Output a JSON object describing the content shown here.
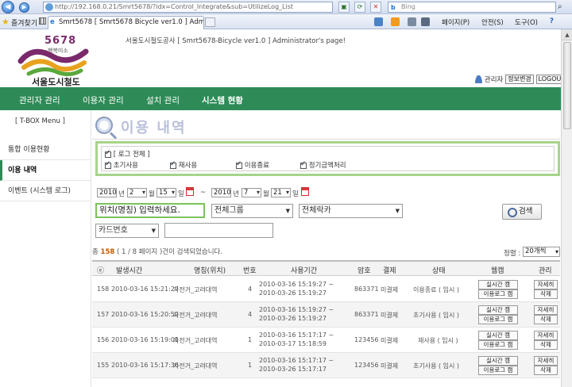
{
  "browser": {
    "address": "http://192.168.0.21/Smrt5678/?idx=Control_Integrate&sub=UtilizeLog_List",
    "search_placeholder": "Bing",
    "favorites_label": "즐겨찾기",
    "tab_title": "Smrt5678 [ Smrt5678 Bicycle ver1.0 ] Adminis...",
    "commands": {
      "page": "페이지(P)",
      "safety": "안전(S)",
      "tools": "도구(O)",
      "help": "?"
    }
  },
  "header": {
    "logo_number": "5678",
    "logo_sub": "행복미소",
    "logo_name": "서울도시철도",
    "caption": "서울도시철도공사 [ Smrt5678-Bicycle ver1.0 ] Administrator's page!",
    "admin_label": "관리자",
    "info_change": "정보변경",
    "logout": "LOGOUT"
  },
  "nav": [
    "관리자 관리",
    "이용자 관리",
    "설치 관리",
    "시스템 현황"
  ],
  "sidebar": {
    "title": "[ T-BOX Menu ]",
    "items": [
      "통합 이용현황",
      "이용 내역",
      "이벤트 (시스템 로그)"
    ]
  },
  "page": {
    "title": "이용 내역"
  },
  "filters": {
    "all_label": "[ 로그 전체 ]",
    "options": [
      "초기사용",
      "재사용",
      "이용종료",
      "정기금액처리"
    ]
  },
  "date": {
    "from_year": "2010",
    "from_month": "2",
    "from_day": "15",
    "to_year": "2010",
    "to_month": "7",
    "to_day": "21",
    "year_unit": "년",
    "month_unit": "월",
    "day_unit": "일",
    "tilde": "~"
  },
  "search": {
    "location_placeholder": "위치(명칭) 입력하세요.",
    "group_select": "전체그룹",
    "rack_select": "전체락카",
    "card_select": "카드번호",
    "button": "검색"
  },
  "results": {
    "prefix": "총",
    "count": "158",
    "suffix": "( 1 / 8 페이지 )건이 검색되었습니다.",
    "sort_label": "정렬 :",
    "sort_value": "20개씩"
  },
  "table": {
    "headers": [
      "ⓔ",
      "발생시간",
      "명칭(위치)",
      "번호",
      "사용기간",
      "암호",
      "결제",
      "상태",
      "웹캠",
      "관리"
    ],
    "rows": [
      {
        "no": "158",
        "time": "2010-03-16 15:21:27",
        "name": "자전거_고려대역",
        "num": "4",
        "period": "2010-03-16 15:19:27 ~ 2010-03-26 15:19:27",
        "pw": "863371",
        "pay": "미결제",
        "status": "이용종료 ( 임시 )",
        "cam1": "실시간 캠",
        "cam2": "이용로그 캠",
        "m1": "자세히",
        "m2": "삭제"
      },
      {
        "no": "157",
        "time": "2010-03-16 15:20:52",
        "name": "자전거_고려대역",
        "num": "4",
        "period": "2010-03-16 15:19:27 ~ 2010-03-26 15:19:27",
        "pw": "863371",
        "pay": "미결제",
        "status": "초기사용 ( 임시 )",
        "cam1": "실시간 캠",
        "cam2": "이용로그 캠",
        "m1": "자세히",
        "m2": "삭제"
      },
      {
        "no": "156",
        "time": "2010-03-16 15:19:01",
        "name": "자전거_고려대역",
        "num": "1",
        "period": "2010-03-16 15:17:17 ~ 2010-03-17 15:18:59",
        "pw": "123456",
        "pay": "미결제",
        "status": "재사용 ( 임시 )",
        "cam1": "실시간 캠",
        "cam2": "이용로그 캠",
        "m1": "자세히",
        "m2": "삭제"
      },
      {
        "no": "155",
        "time": "2010-03-16 15:17:36",
        "name": "자전거_고려대역",
        "num": "1",
        "period": "2010-03-16 15:17:17 ~ 2010-03-26 15:17:17",
        "pw": "123456",
        "pay": "미결제",
        "status": "초기사용 ( 임시 )",
        "cam1": "실시간 캠",
        "cam2": "이용로그 캠",
        "m1": "자세히",
        "m2": "삭제"
      }
    ]
  },
  "colors": {
    "nav_green": "#2e8b57",
    "filter_border": "#a6d48a",
    "title_lavender": "#b9c0da",
    "count_orange": "#c05a00"
  }
}
